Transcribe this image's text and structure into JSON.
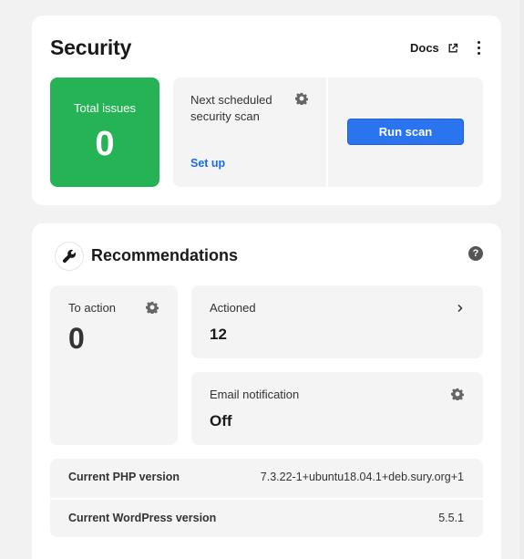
{
  "security": {
    "title": "Security",
    "docs_label": "Docs",
    "total_issues_label": "Total issues",
    "total_issues_count": "0",
    "next_scan_label": "Next scheduled security scan",
    "setup_label": "Set up",
    "run_scan_label": "Run scan"
  },
  "recommendations": {
    "title": "Recommendations",
    "to_action_label": "To action",
    "to_action_count": "0",
    "actioned_label": "Actioned",
    "actioned_count": "12",
    "email_label": "Email notification",
    "email_value": "Off",
    "versions": [
      {
        "name": "Current PHP version",
        "value": "7.3.22-1+ubuntu18.04.1+deb.sury.org+1"
      },
      {
        "name": "Current WordPress version",
        "value": "5.5.1"
      }
    ]
  },
  "colors": {
    "issues_green": "#26b356",
    "primary_blue": "#2b74f0",
    "link_blue": "#1a6be0"
  },
  "icons": [
    "external-link-icon",
    "kebab-menu-icon",
    "gear-icon",
    "wrench-icon",
    "help-icon",
    "chevron-right-icon"
  ]
}
